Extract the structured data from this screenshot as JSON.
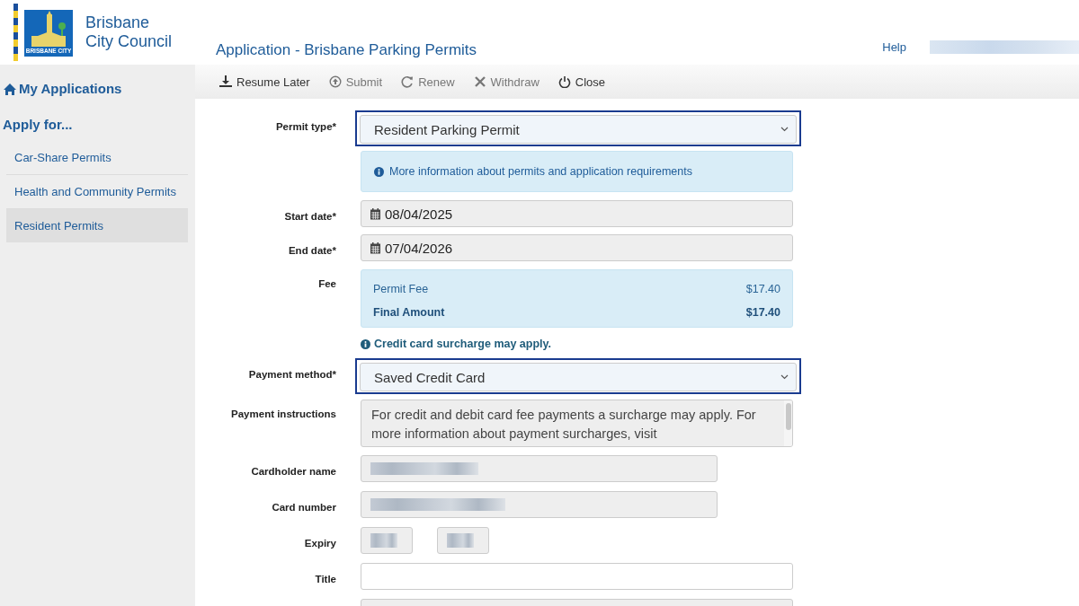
{
  "header": {
    "logo": {
      "line1": "Brisbane",
      "line2": "City Council",
      "badge": "BRISBANE CITY"
    },
    "page_title": "Application - Brisbane Parking Permits",
    "help_link": "Help"
  },
  "sidebar": {
    "home": "My Applications",
    "section": "Apply for...",
    "items": [
      {
        "label": "Car-Share Permits",
        "selected": false
      },
      {
        "label": "Health and Community Permits",
        "selected": false
      },
      {
        "label": "Resident Permits",
        "selected": true
      }
    ]
  },
  "toolbar": [
    {
      "label": "Resume Later",
      "kind": "download",
      "disabled": false
    },
    {
      "label": "Submit",
      "kind": "upload",
      "disabled": true
    },
    {
      "label": "Renew",
      "kind": "refresh",
      "disabled": true
    },
    {
      "label": "Withdraw",
      "kind": "cross",
      "disabled": true
    },
    {
      "label": "Close",
      "kind": "power",
      "disabled": false
    }
  ],
  "form": {
    "fields": [
      {
        "kind": "select",
        "label": "Permit type*",
        "value": "Resident Parking Permit",
        "focused": true
      },
      {
        "kind": "info",
        "text": "More information about permits and application requirements"
      },
      {
        "kind": "date",
        "label": "Start date*",
        "value": "08/04/2025"
      },
      {
        "kind": "date",
        "label": "End date*",
        "value": "07/04/2026"
      },
      {
        "kind": "fee",
        "label": "Fee",
        "rows": [
          {
            "name": "Permit Fee",
            "amount": "$17.40",
            "total": false
          },
          {
            "name": "Final Amount",
            "amount": "$17.40",
            "total": true
          }
        ]
      },
      {
        "kind": "note",
        "text": "Credit card surcharge may apply."
      },
      {
        "kind": "select",
        "label": "Payment method*",
        "value": "Saved Credit Card",
        "focused": true
      },
      {
        "kind": "textarea",
        "label": "Payment instructions",
        "value": "For credit and debit card fee payments a surcharge may apply. For more information about payment surcharges, visit"
      },
      {
        "kind": "redacted",
        "label": "Cardholder name"
      },
      {
        "kind": "redacted",
        "label": "Card number"
      },
      {
        "kind": "expiry",
        "label": "Expiry"
      },
      {
        "kind": "text",
        "label": "Title"
      }
    ]
  }
}
